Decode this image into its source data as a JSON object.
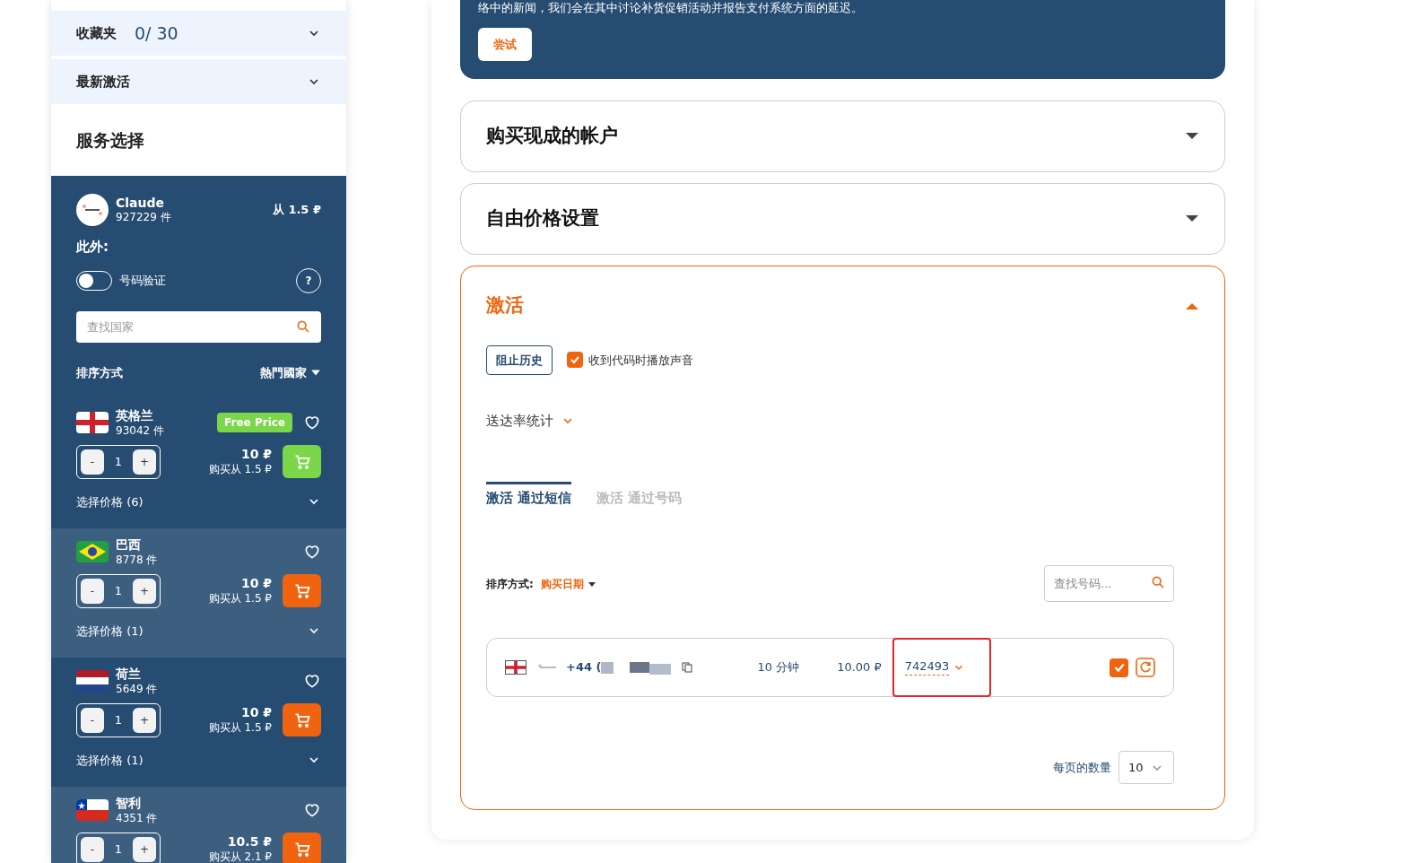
{
  "sidebar": {
    "favorites": {
      "label": "收藏夹",
      "count": "0/ 30"
    },
    "recent": {
      "label": "最新激活"
    },
    "title": "服务选择",
    "service": {
      "name": "Claude",
      "count": "927229 件",
      "price": "从 1.5 ₽",
      "extra_label": "此外:",
      "toggle": {
        "label": "号码验证",
        "on": false
      },
      "help": "?"
    },
    "country_search": {
      "placeholder": "查找国家"
    },
    "sort": {
      "label": "排序方式",
      "value": "熱門國家"
    },
    "countries": [
      {
        "kind": "england",
        "name": "英格兰",
        "count": "93042 件",
        "badge": "Free Price",
        "qty": "1",
        "minus": "-",
        "plus": "+",
        "price": "10 ₽",
        "buy_from": "购买从 1.5 ₽",
        "featured": true,
        "options": "选择价格 (6)"
      },
      {
        "kind": "brazil",
        "name": "巴西",
        "count": "8778 件",
        "qty": "1",
        "minus": "-",
        "plus": "+",
        "price": "10 ₽",
        "buy_from": "购买从 1.5 ₽",
        "featured": false,
        "options": "选择价格 (1)"
      },
      {
        "kind": "netherlands",
        "name": "荷兰",
        "count": "5649 件",
        "qty": "1",
        "minus": "-",
        "plus": "+",
        "price": "10 ₽",
        "buy_from": "购买从 1.5 ₽",
        "featured": false,
        "options": "选择价格 (1)"
      },
      {
        "kind": "chile",
        "name": "智利",
        "count": "4351 件",
        "qty": "1",
        "minus": "-",
        "plus": "+",
        "price": "10.5 ₽",
        "buy_from": "购买从 2.1 ₽",
        "featured": false
      }
    ]
  },
  "banner": {
    "text": "络中的新闻，我们会在其中讨论补货促销活动并报告支付系统方面的延迟。",
    "button": "尝试"
  },
  "sections": [
    {
      "title": "购买现成的帐户",
      "expanded": false
    },
    {
      "title": "自由价格设置",
      "expanded": false
    },
    {
      "title": "激活",
      "expanded": true
    }
  ],
  "activation": {
    "block_history": "阻止历史",
    "sound": {
      "label": "收到代码时播放声音",
      "checked": true
    },
    "stats": "送达率统计",
    "tabs": [
      {
        "label": "激活 通过短信",
        "selected": true
      },
      {
        "label": "激活 通过号码",
        "selected": false
      }
    ],
    "sort": {
      "label": "排序方式:",
      "value": "购买日期"
    },
    "search": {
      "placeholder": "查找号码..."
    },
    "rows": [
      {
        "phone": "+44 (",
        "time": "10 分钟",
        "price": "10.00 ₽",
        "code": "742493",
        "done": true
      }
    ],
    "per_page": {
      "label": "每页的数量",
      "value": "10"
    }
  }
}
